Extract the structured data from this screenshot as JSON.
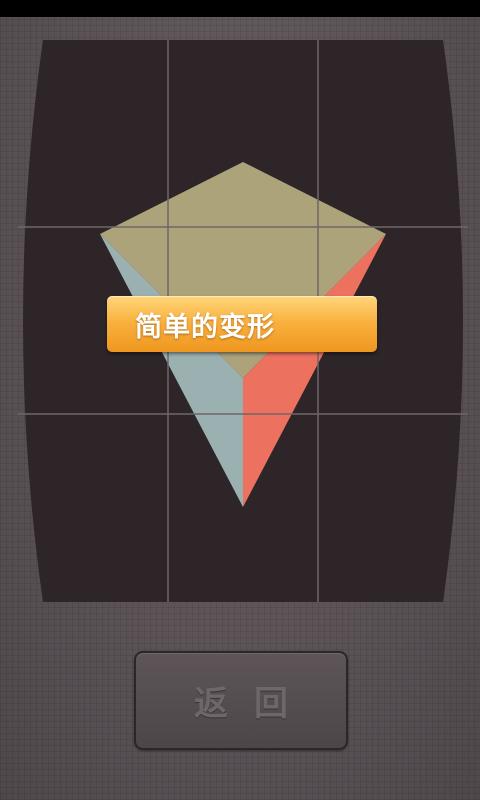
{
  "puzzle": {
    "grid": {
      "rows": 3,
      "cols": 3
    },
    "colors": {
      "board": "#2d2528",
      "top_face": "#ada37b",
      "left_face": "#9bb0b1",
      "right_face": "#ec725f",
      "grid_line": "#6e6668"
    }
  },
  "banner": {
    "title": "简单的变形"
  },
  "footer": {
    "back_label": "返回"
  }
}
